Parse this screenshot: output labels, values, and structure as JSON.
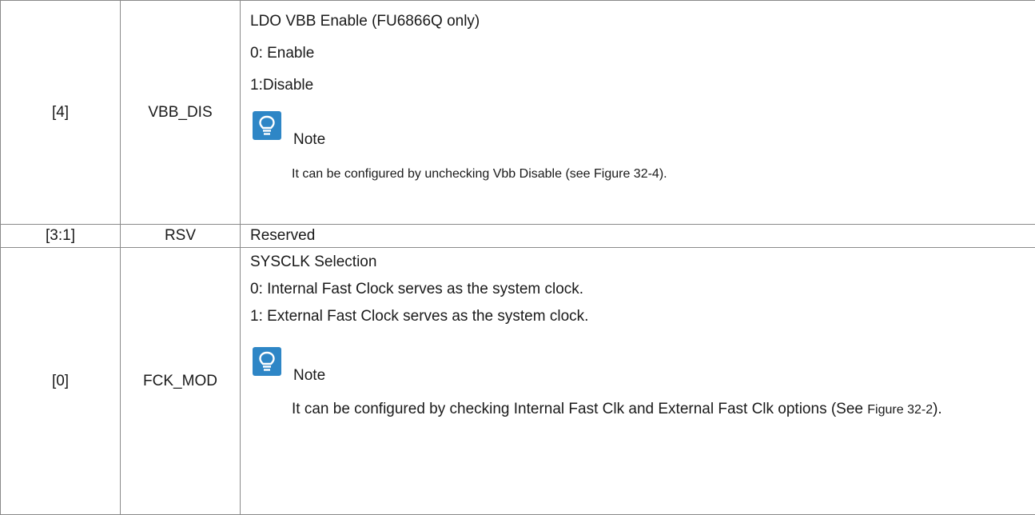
{
  "rows": [
    {
      "bit": "[4]",
      "name": "VBB_DIS",
      "desc": {
        "title": "LDO VBB Enable (FU6866Q only)",
        "opt0": "0: Enable",
        "opt1": "1:Disable",
        "note_label": "Note",
        "note_text": "It can be configured by unchecking Vbb Disable (see Figure 32-4)."
      }
    },
    {
      "bit": "[3:1]",
      "name": "RSV",
      "desc": {
        "title": "Reserved"
      }
    },
    {
      "bit": "[0]",
      "name": "FCK_MOD",
      "desc": {
        "title": "SYSCLK Selection",
        "opt0": "0: Internal Fast Clock serves as the system clock.",
        "opt1": "1: External Fast Clock serves as the system clock.",
        "note_label": "Note",
        "note_text_main": "It can be configured by checking Internal Fast Clk and External Fast Clk options (See",
        "note_text_ref": "Figure 32-2",
        "note_text_end": ")."
      }
    }
  ],
  "colors": {
    "note_icon_bg": "#2e86c6",
    "border": "#8a8a8a"
  },
  "icons": {
    "note": "lightbulb-icon"
  }
}
